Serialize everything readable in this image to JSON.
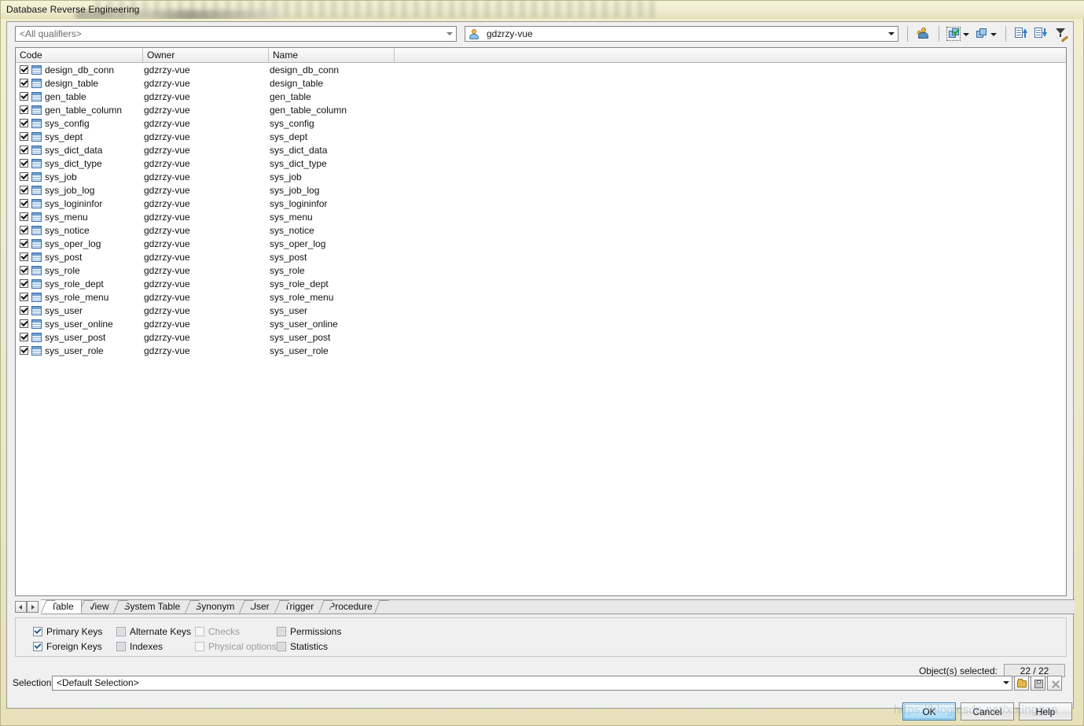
{
  "window": {
    "title": "Database Reverse Engineering"
  },
  "topbar": {
    "qualifier_combo": {
      "value": "<All qualifiers>",
      "name": "qualifier-dropdown"
    },
    "owner_combo": {
      "value": "gdzrzy-vue",
      "icon": "user-icon",
      "name": "owner-dropdown"
    },
    "toolbar": [
      {
        "label": "",
        "icon": "user-filter-icon",
        "name": "user-filter-button"
      },
      {
        "label": "",
        "icon": "select-all-icon",
        "name": "select-all-button"
      },
      {
        "label": "",
        "icon": "deselect-all-icon",
        "name": "deselect-all-button"
      },
      {
        "label": "",
        "icon": "sort-ascending-icon",
        "name": "sort-ascending-button"
      },
      {
        "label": "",
        "icon": "sort-descending-icon",
        "name": "sort-descending-button"
      },
      {
        "label": "",
        "icon": "filter-edit-icon",
        "name": "filter-edit-button"
      },
      {
        "label": "",
        "icon": "filter-apply-icon",
        "name": "filter-apply-button"
      }
    ]
  },
  "list": {
    "columns": [
      "Code",
      "Owner",
      "Name"
    ],
    "rows": [
      {
        "checked": true,
        "code": "design_db_conn",
        "owner": "gdzrzy-vue",
        "name": "design_db_conn"
      },
      {
        "checked": true,
        "code": "design_table",
        "owner": "gdzrzy-vue",
        "name": "design_table"
      },
      {
        "checked": true,
        "code": "gen_table",
        "owner": "gdzrzy-vue",
        "name": "gen_table"
      },
      {
        "checked": true,
        "code": "gen_table_column",
        "owner": "gdzrzy-vue",
        "name": "gen_table_column"
      },
      {
        "checked": true,
        "code": "sys_config",
        "owner": "gdzrzy-vue",
        "name": "sys_config"
      },
      {
        "checked": true,
        "code": "sys_dept",
        "owner": "gdzrzy-vue",
        "name": "sys_dept"
      },
      {
        "checked": true,
        "code": "sys_dict_data",
        "owner": "gdzrzy-vue",
        "name": "sys_dict_data"
      },
      {
        "checked": true,
        "code": "sys_dict_type",
        "owner": "gdzrzy-vue",
        "name": "sys_dict_type"
      },
      {
        "checked": true,
        "code": "sys_job",
        "owner": "gdzrzy-vue",
        "name": "sys_job"
      },
      {
        "checked": true,
        "code": "sys_job_log",
        "owner": "gdzrzy-vue",
        "name": "sys_job_log"
      },
      {
        "checked": true,
        "code": "sys_logininfor",
        "owner": "gdzrzy-vue",
        "name": "sys_logininfor"
      },
      {
        "checked": true,
        "code": "sys_menu",
        "owner": "gdzrzy-vue",
        "name": "sys_menu"
      },
      {
        "checked": true,
        "code": "sys_notice",
        "owner": "gdzrzy-vue",
        "name": "sys_notice"
      },
      {
        "checked": true,
        "code": "sys_oper_log",
        "owner": "gdzrzy-vue",
        "name": "sys_oper_log"
      },
      {
        "checked": true,
        "code": "sys_post",
        "owner": "gdzrzy-vue",
        "name": "sys_post"
      },
      {
        "checked": true,
        "code": "sys_role",
        "owner": "gdzrzy-vue",
        "name": "sys_role"
      },
      {
        "checked": true,
        "code": "sys_role_dept",
        "owner": "gdzrzy-vue",
        "name": "sys_role_dept"
      },
      {
        "checked": true,
        "code": "sys_role_menu",
        "owner": "gdzrzy-vue",
        "name": "sys_role_menu"
      },
      {
        "checked": true,
        "code": "sys_user",
        "owner": "gdzrzy-vue",
        "name": "sys_user"
      },
      {
        "checked": true,
        "code": "sys_user_online",
        "owner": "gdzrzy-vue",
        "name": "sys_user_online"
      },
      {
        "checked": true,
        "code": "sys_user_post",
        "owner": "gdzrzy-vue",
        "name": "sys_user_post"
      },
      {
        "checked": true,
        "code": "sys_user_role",
        "owner": "gdzrzy-vue",
        "name": "sys_user_role"
      }
    ]
  },
  "tabs": [
    {
      "label": "Table",
      "active": true
    },
    {
      "label": "View",
      "active": false
    },
    {
      "label": "System Table",
      "active": false
    },
    {
      "label": "Synonym",
      "active": false
    },
    {
      "label": "User",
      "active": false
    },
    {
      "label": "Trigger",
      "active": false
    },
    {
      "label": "Procedure",
      "active": false
    }
  ],
  "options": [
    {
      "label": "Primary Keys",
      "checked": true,
      "disabled": false
    },
    {
      "label": "Foreign Keys",
      "checked": true,
      "disabled": false
    },
    {
      "label": "Alternate Keys",
      "checked": false,
      "disabled": false
    },
    {
      "label": "Indexes",
      "checked": false,
      "disabled": false
    },
    {
      "label": "Checks",
      "checked": false,
      "disabled": true
    },
    {
      "label": "Physical options",
      "checked": false,
      "disabled": true
    },
    {
      "label": "Permissions",
      "checked": false,
      "disabled": false
    },
    {
      "label": "Statistics",
      "checked": false,
      "disabled": false
    }
  ],
  "status": {
    "count_label": "Object(s) selected:",
    "count_value": "22 / 22"
  },
  "selection": {
    "label": "Selection:",
    "value": "<Default Selection>",
    "buttons": [
      {
        "icon": "folder-open-icon",
        "name": "open-selection-button"
      },
      {
        "icon": "save-icon",
        "name": "save-selection-button"
      },
      {
        "icon": "delete-x-icon",
        "name": "delete-selection-button"
      }
    ]
  },
  "dialog_buttons": [
    {
      "label": "OK",
      "default": true
    },
    {
      "label": "Cancel",
      "default": false
    },
    {
      "label": "Help",
      "default": false
    }
  ],
  "watermark": {
    "text": "https://blog.csdn.net/xujinggen"
  }
}
